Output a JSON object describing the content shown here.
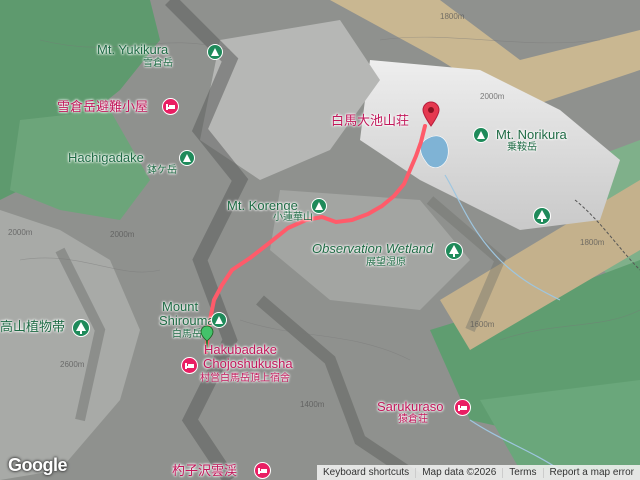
{
  "map": {
    "labels": {
      "yukikura_en": "Mt. Yukikura",
      "yukikura_zh": "雪倉岳",
      "yukikura_hut": "雪倉岳避難小屋",
      "hachigadake_en": "Hachigadake",
      "hachigadake_zh": "鉢ケ岳",
      "hakuba_oike": "白馬大池山荘",
      "norikura_en": "Mt. Norikura",
      "norikura_zh": "乗鞍岳",
      "korenge_en": "Mt. Korenge",
      "korenge_zh": "小蓮華山",
      "observation_en": "Observation Wetland",
      "observation_zh": "展望湿原",
      "alpine_plants": "高山植物帯",
      "shirouma_en_1": "Mount",
      "shirouma_en_2": "Shirouma",
      "shirouma_zh": "白馬岳",
      "chojo_en_1": "Hakubadake",
      "chojo_en_2": "Chojoshukusha",
      "chojo_zh": "村営白馬岳頂上宿舎",
      "sarukura_en": "Sarukuraso",
      "sarukura_zh": "猿倉荘",
      "bottom_zh": "杓子沢雲渓"
    },
    "contours": [
      "1800m",
      "2000m",
      "2000m",
      "2000m",
      "2600m",
      "1800m",
      "1600m",
      "1400m"
    ],
    "route_color": "#ff5b6a"
  },
  "footer": {
    "logo": "Google",
    "keyboard_shortcuts": "Keyboard shortcuts",
    "map_data": "Map data ©2026",
    "terms": "Terms",
    "report": "Report a map error"
  }
}
